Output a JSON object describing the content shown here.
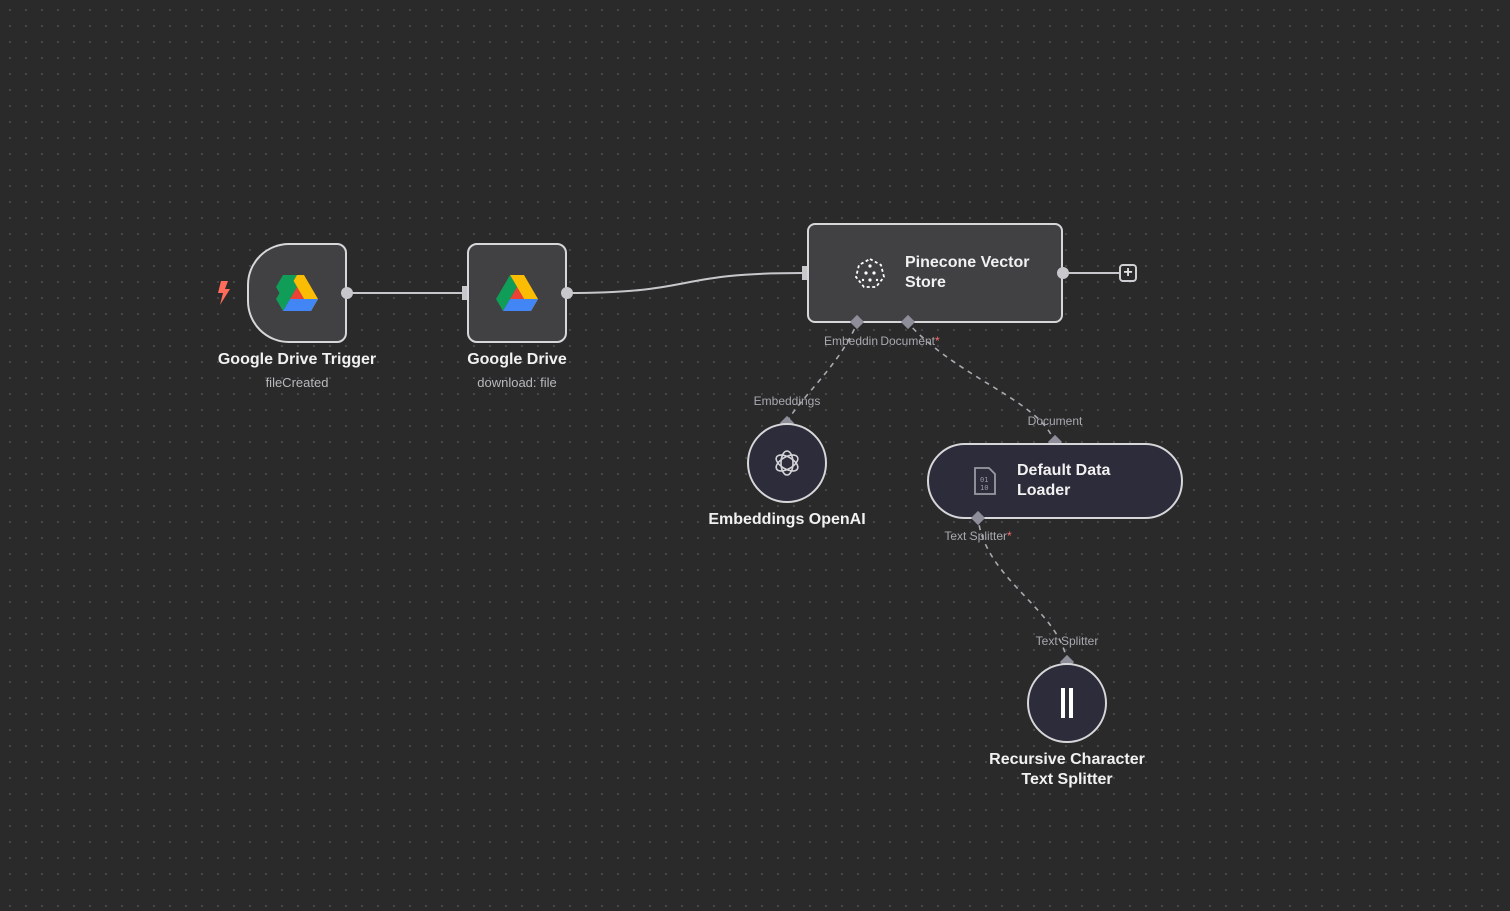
{
  "canvas": {
    "background": "#2a2a2b"
  },
  "nodes": {
    "drive_trigger": {
      "title": "Google Drive Trigger",
      "subtitle": "fileCreated",
      "icon": "google-drive-icon"
    },
    "drive": {
      "title": "Google Drive",
      "subtitle": "download: file",
      "icon": "google-drive-icon"
    },
    "pinecone": {
      "title_line1": "Pinecone Vector",
      "title_line2": "Store",
      "icon": "pinecone-icon"
    },
    "embeddings": {
      "title": "Embeddings OpenAI",
      "icon": "openai-icon"
    },
    "loader": {
      "title_line1": "Default Data",
      "title_line2": "Loader",
      "icon": "document-binary-icon"
    },
    "splitter": {
      "title_line1": "Recursive Character",
      "title_line2": "Text Splitter",
      "icon": "text-splitter-icon"
    }
  },
  "ports": {
    "pinecone_embedding": "Embeddin",
    "pinecone_document": "Document",
    "required_mark": "*",
    "embeddings_out": "Embeddings",
    "loader_in": "Document",
    "loader_splitter": "Text Splitter",
    "splitter_out": "Text Splitter"
  },
  "colors": {
    "node_border": "#d7d7da",
    "node_fill": "#414143",
    "sub_node_fill": "#2c2c3a",
    "required": "#ff6d6d",
    "trigger_bolt": "#ff6d5a"
  }
}
